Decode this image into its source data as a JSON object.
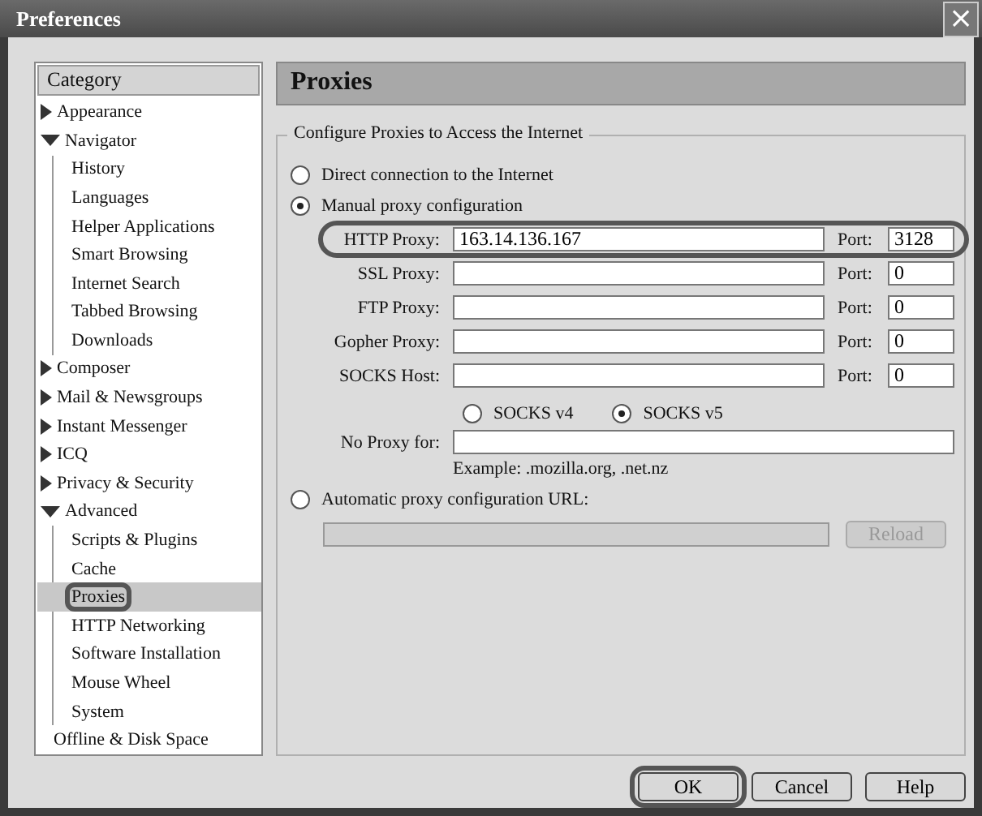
{
  "window": {
    "title": "Preferences",
    "close": "×"
  },
  "sidebar": {
    "header": "Category",
    "items": [
      {
        "label": "Appearance",
        "expanded": false,
        "selected": false,
        "highlighted": false
      },
      {
        "label": "Navigator",
        "expanded": true,
        "selected": false,
        "highlighted": false,
        "children": [
          {
            "label": "History",
            "selected": false,
            "highlighted": false
          },
          {
            "label": "Languages",
            "selected": false,
            "highlighted": false
          },
          {
            "label": "Helper Applications",
            "selected": false,
            "highlighted": false
          },
          {
            "label": "Smart Browsing",
            "selected": false,
            "highlighted": false
          },
          {
            "label": "Internet Search",
            "selected": false,
            "highlighted": false
          },
          {
            "label": "Tabbed Browsing",
            "selected": false,
            "highlighted": false
          },
          {
            "label": "Downloads",
            "selected": false,
            "highlighted": false
          }
        ]
      },
      {
        "label": "Composer",
        "expanded": false,
        "selected": false,
        "highlighted": false
      },
      {
        "label": "Mail & Newsgroups",
        "expanded": false,
        "selected": false,
        "highlighted": false
      },
      {
        "label": "Instant Messenger",
        "expanded": false,
        "selected": false,
        "highlighted": false
      },
      {
        "label": "ICQ",
        "expanded": false,
        "selected": false,
        "highlighted": false
      },
      {
        "label": "Privacy & Security",
        "expanded": false,
        "selected": false,
        "highlighted": false
      },
      {
        "label": "Advanced",
        "expanded": true,
        "selected": false,
        "highlighted": false,
        "children": [
          {
            "label": "Scripts & Plugins",
            "selected": false,
            "highlighted": false
          },
          {
            "label": "Cache",
            "selected": false,
            "highlighted": false
          },
          {
            "label": "Proxies",
            "selected": true,
            "highlighted": true
          },
          {
            "label": "HTTP Networking",
            "selected": false,
            "highlighted": false
          },
          {
            "label": "Software Installation",
            "selected": false,
            "highlighted": false
          },
          {
            "label": "Mouse Wheel",
            "selected": false,
            "highlighted": false
          },
          {
            "label": "System",
            "selected": false,
            "highlighted": false
          }
        ]
      },
      {
        "label": "Offline & Disk Space",
        "selected": false,
        "highlighted": false
      }
    ]
  },
  "panel": {
    "title": "Proxies",
    "group_title": "Configure Proxies to Access the Internet",
    "direct": {
      "label": "Direct connection to the Internet",
      "selected": false
    },
    "manual": {
      "label": "Manual proxy configuration",
      "selected": true
    },
    "proxies": [
      {
        "label": "HTTP Proxy:",
        "value": "163.14.136.167",
        "port_label": "Port:",
        "port": "3128",
        "highlighted": true
      },
      {
        "label": "SSL Proxy:",
        "port_label": "Port:",
        "port": "0",
        "highlighted": false
      },
      {
        "label": "FTP Proxy:",
        "port_label": "Port:",
        "port": "0",
        "highlighted": false
      },
      {
        "label": "Gopher Proxy:",
        "port_label": "Port:",
        "port": "0",
        "highlighted": false
      },
      {
        "label": "SOCKS Host:",
        "port_label": "Port:",
        "port": "0",
        "highlighted": false
      }
    ],
    "socks": [
      {
        "label": "SOCKS v4",
        "selected": false
      },
      {
        "label": "SOCKS v5",
        "selected": true
      }
    ],
    "no_proxy": {
      "label": "No Proxy for:",
      "example": "Example: .mozilla.org, .net.nz"
    },
    "auto": {
      "label": "Automatic proxy configuration URL:",
      "selected": false,
      "reload": "Reload",
      "disabled": true
    }
  },
  "buttons": [
    {
      "label": "OK",
      "highlighted": true
    },
    {
      "label": "Cancel",
      "highlighted": false
    },
    {
      "label": "Help",
      "highlighted": false
    }
  ]
}
